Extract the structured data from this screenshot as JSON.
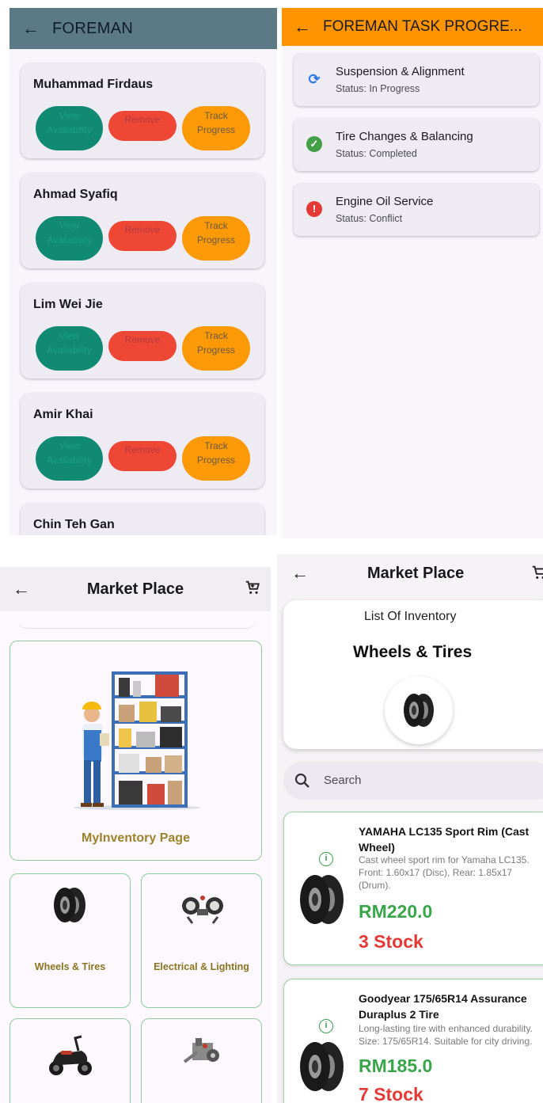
{
  "foreman": {
    "title": "FOREMAN",
    "buttons": {
      "view": "View Availability",
      "remove": "Remove",
      "track": "Track Progress"
    },
    "foremen": [
      {
        "name": "Muhammad Firdaus"
      },
      {
        "name": "Ahmad Syafiq"
      },
      {
        "name": "Lim Wei Jie"
      },
      {
        "name": "Amir Khai"
      },
      {
        "name": "Chin Teh Gan"
      }
    ]
  },
  "tasks": {
    "title": "FOREMAN TASK PROGRE...",
    "items": [
      {
        "title": "Suspension & Alignment",
        "status": "Status: In Progress",
        "icon": "sync-icon",
        "color": "#2f7ee6"
      },
      {
        "title": "Tire Changes & Balancing",
        "status": "Status: Completed",
        "icon": "check-circle-icon",
        "color": "#43a047"
      },
      {
        "title": "Engine Oil Service",
        "status": "Status: Conflict",
        "icon": "error-icon",
        "color": "#e53935"
      }
    ]
  },
  "marketplace": {
    "title": "Market Place",
    "inventory_label": "MyInventory Page",
    "categories": [
      {
        "label": "Wheels & Tires",
        "icon": "tire-icon"
      },
      {
        "label": "Electrical & Lighting",
        "icon": "headlight-icon"
      },
      {
        "label": "",
        "icon": "scooter-icon"
      },
      {
        "label": "",
        "icon": "engine-parts-icon"
      }
    ]
  },
  "inventory": {
    "title": "Market Place",
    "subtitle": "List Of Inventory",
    "category": "Wheels & Tires",
    "search_placeholder": "Search",
    "products": [
      {
        "name": "YAMAHA LC135 Sport Rim (Cast Wheel)",
        "description": "Cast wheel sport rim for Yamaha LC135. Front: 1.60x17 (Disc), Rear: 1.85x17 (Drum).",
        "price": "RM220.0",
        "stock": "3 Stock"
      },
      {
        "name": "Goodyear 175/65R14 Assurance Duraplus 2 Tire",
        "description": "Long-lasting tire with enhanced durability. Size: 175/65R14. Suitable for city driving.",
        "price": "RM185.0",
        "stock": "7 Stock"
      }
    ]
  }
}
